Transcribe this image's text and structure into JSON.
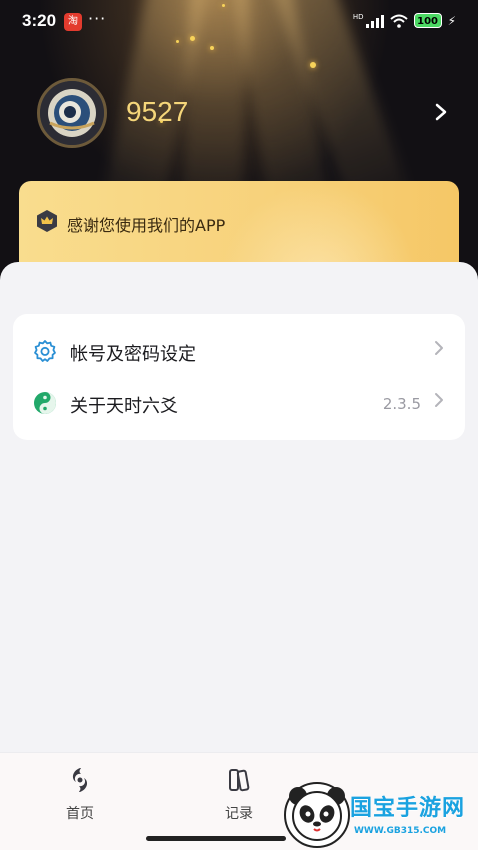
{
  "status_bar": {
    "time": "3:20",
    "app_badge": "淘",
    "more": "···",
    "network": "HD",
    "battery": "100"
  },
  "profile": {
    "username": "9527"
  },
  "banner": {
    "text": "感谢您使用我们的APP"
  },
  "settings": {
    "items": [
      {
        "label": "帐号及密码设定",
        "icon": "gear-icon",
        "value": ""
      },
      {
        "label": "关于天时六爻",
        "icon": "yin-yang-icon",
        "value": "2.3.5"
      }
    ]
  },
  "tabbar": {
    "tabs": [
      {
        "label": "首页",
        "icon": "home-logo-icon"
      },
      {
        "label": "记录",
        "icon": "records-icon"
      }
    ]
  },
  "watermark": {
    "title": "国宝手游网",
    "url": "WWW.GB315.COM"
  },
  "colors": {
    "accent_gold": "#f5d67a",
    "banner_gold": "#f7d17a",
    "icon_blue": "#2a8fd4",
    "icon_green": "#22a86a"
  }
}
